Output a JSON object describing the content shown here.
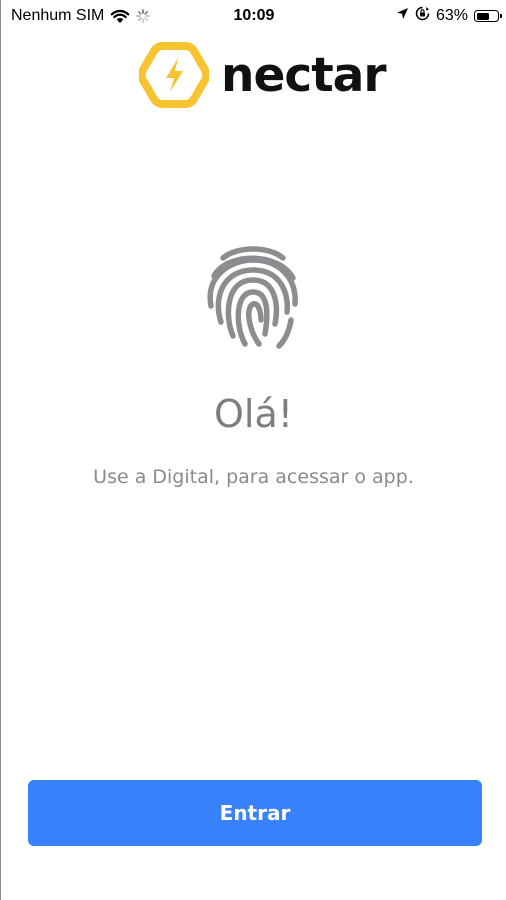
{
  "status_bar": {
    "carrier": "Nenhum SIM",
    "time": "10:09",
    "battery_percent": "63%",
    "battery_level": 0.63,
    "icons": [
      "wifi-icon",
      "activity-spinner-icon",
      "location-arrow-icon",
      "orientation-lock-icon",
      "battery-icon"
    ]
  },
  "brand": {
    "name": "nectar",
    "logo_icon": "bolt-hexagon-icon",
    "accent_color": "#F7C42F"
  },
  "main": {
    "icon": "fingerprint-icon",
    "greeting": "Olá!",
    "subtitle": "Use a Digital, para acessar o app."
  },
  "actions": {
    "enter_label": "Entrar",
    "button_color": "#3782FA"
  }
}
